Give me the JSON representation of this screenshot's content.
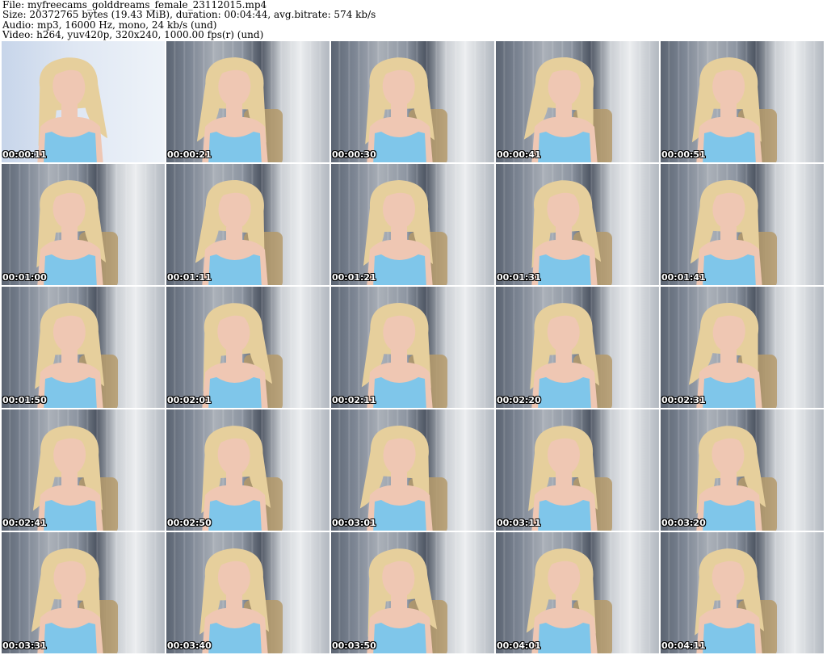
{
  "header": {
    "file_line": "File: myfreecams_golddreams_female_23112015.mp4",
    "size_line": "Size: 20372765 bytes (19.43 MiB), duration: 00:04:44, avg.bitrate: 574 kb/s",
    "audio_line": "Audio: mp3, 16000 Hz, mono, 24 kb/s (und)",
    "video_line": "Video: h264, yuv420p, 320x240, 1000.00 fps(r) (und)"
  },
  "thumbnails": [
    {
      "timestamp": "00:00:11"
    },
    {
      "timestamp": "00:00:21"
    },
    {
      "timestamp": "00:00:30"
    },
    {
      "timestamp": "00:00:41"
    },
    {
      "timestamp": "00:00:51"
    },
    {
      "timestamp": "00:01:00"
    },
    {
      "timestamp": "00:01:11"
    },
    {
      "timestamp": "00:01:21"
    },
    {
      "timestamp": "00:01:31"
    },
    {
      "timestamp": "00:01:41"
    },
    {
      "timestamp": "00:01:50"
    },
    {
      "timestamp": "00:02:01"
    },
    {
      "timestamp": "00:02:11"
    },
    {
      "timestamp": "00:02:20"
    },
    {
      "timestamp": "00:02:31"
    },
    {
      "timestamp": "00:02:41"
    },
    {
      "timestamp": "00:02:50"
    },
    {
      "timestamp": "00:03:01"
    },
    {
      "timestamp": "00:03:11"
    },
    {
      "timestamp": "00:03:20"
    },
    {
      "timestamp": "00:03:31"
    },
    {
      "timestamp": "00:03:40"
    },
    {
      "timestamp": "00:03:50"
    },
    {
      "timestamp": "00:04:01"
    },
    {
      "timestamp": "00:04:11"
    }
  ],
  "colors": {
    "hair": "#e6cf9c",
    "skin": "#efc7b3",
    "top": "#7fc6ea",
    "chair": "#b59a6a"
  }
}
